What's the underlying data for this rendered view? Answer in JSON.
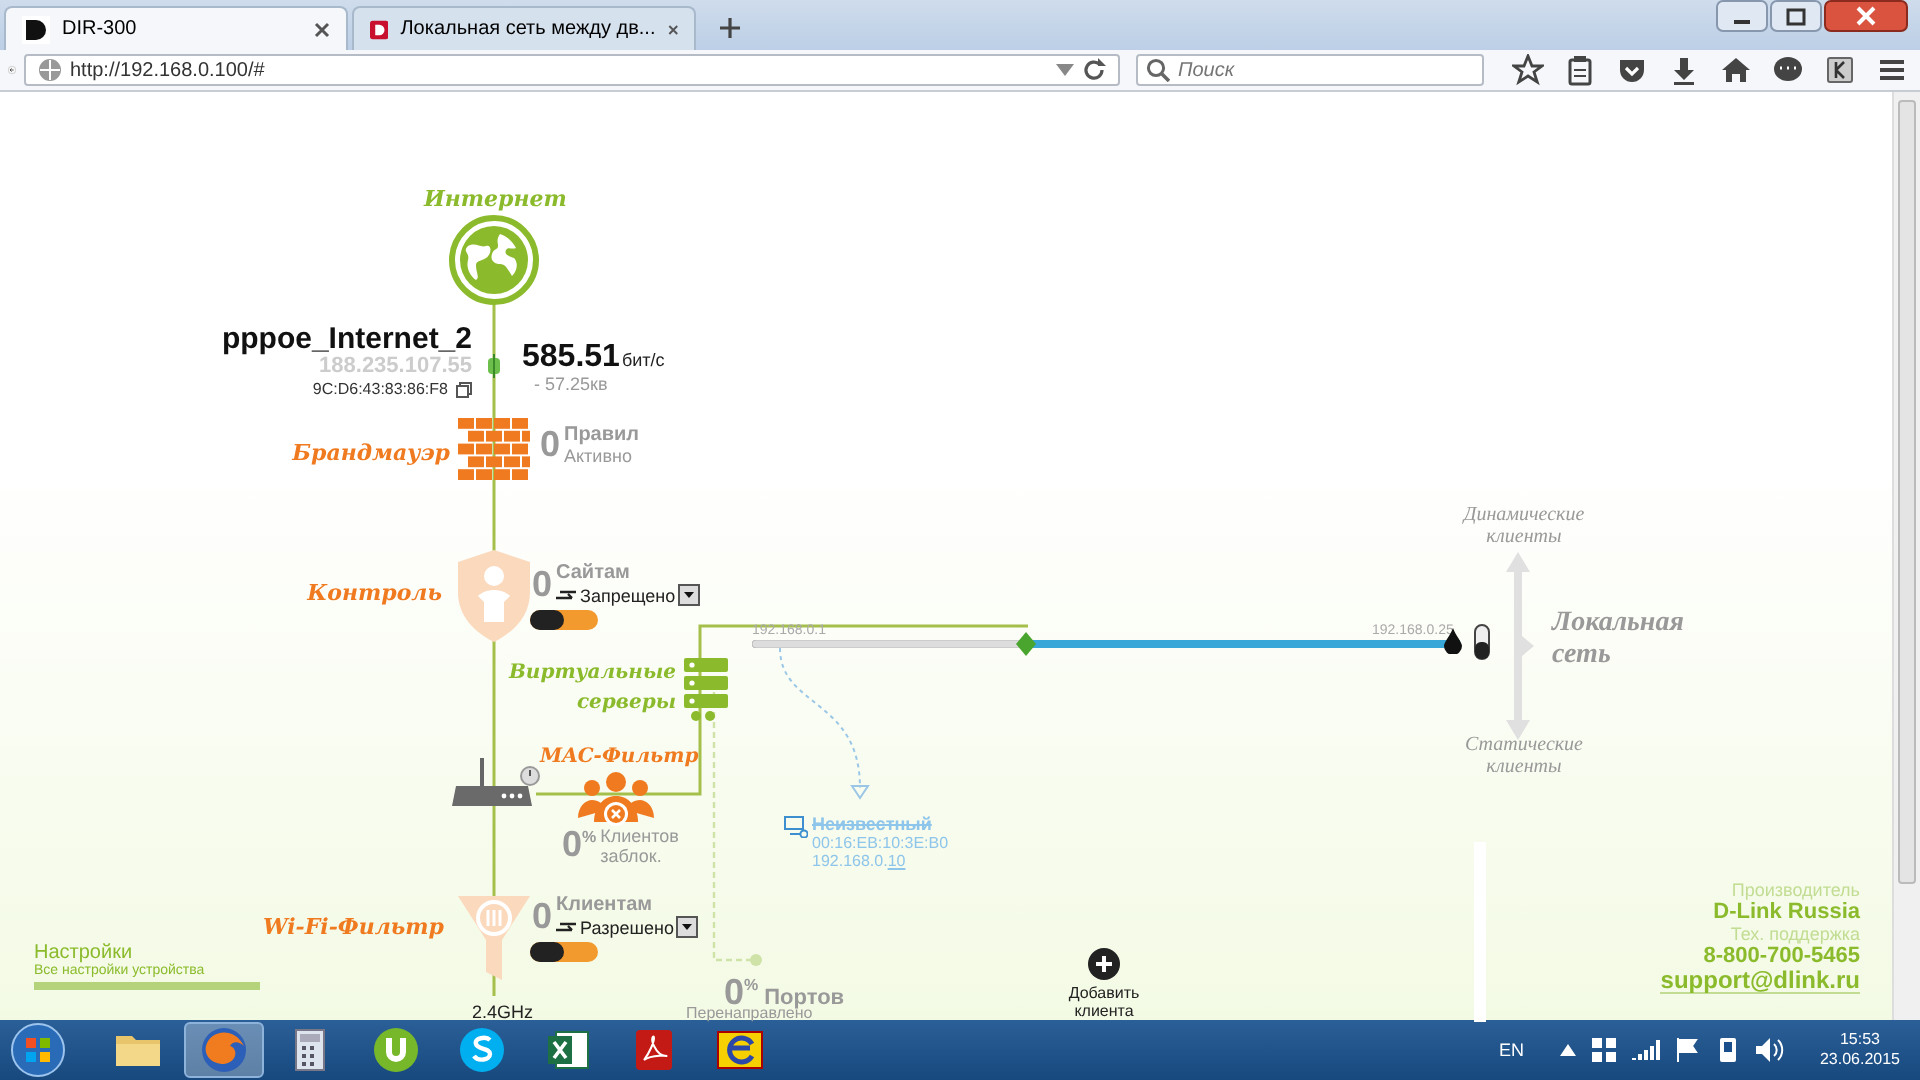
{
  "browser": {
    "tabs": [
      {
        "title": "DIR-300",
        "selected": true
      },
      {
        "title": "Локальная сеть между дв...",
        "selected": false
      }
    ],
    "url": "http://192.168.0.100/#",
    "search": {
      "placeholder": "Поиск"
    }
  },
  "diagram": {
    "internet": {
      "label": "Интернет"
    },
    "connection": {
      "name": "pppoe_Internet_2",
      "ip": "188.235.107.55",
      "mac": "9C:D6:43:83:86:F8",
      "speed": "585.51",
      "speed_unit": "бит/с",
      "traffic": "- 57.25кв"
    },
    "firewall": {
      "label": "Брандмауэр",
      "count": "0",
      "count_label": "Правил",
      "status": "Активно"
    },
    "control": {
      "label": "Контроль",
      "count": "0",
      "count_label": "Сайтам",
      "mode": "Запрещено",
      "on": true
    },
    "virtual_servers": {
      "label": "Виртуальные серверы"
    },
    "mac_filter": {
      "label": "MAC-Фильтр",
      "count": "0$^{%}$",
      "count_label": "Клиентов",
      "status": "заблок."
    },
    "wifi_filter": {
      "label": "Wi-Fi-Фильтр",
      "count": "0",
      "count_label": "Клиентам",
      "mode": "Разрешено",
      "on": true
    },
    "band": "2.4GHz",
    "lan": {
      "gateway_ip": "192.168.0.1",
      "end_ip": "192.168.0.25"
    },
    "client": {
      "name": "Неизвестный",
      "mac": "00:16:EB:10:3E:B0",
      "ip_network": "192.168.0.",
      "ip_host": "10"
    },
    "ports": {
      "count": "0$^{%}$",
      "label": "Портов",
      "status": "Перенаправлено"
    },
    "add_client": "Добавить клиента",
    "local_network": {
      "dynamic": "Динамические клиенты",
      "title": "Локальная сеть",
      "static": "Статические клиенты"
    }
  },
  "settings": {
    "title": "Настройки",
    "subtitle": "Все настройки устройства"
  },
  "vendor": {
    "maker_label": "Производитель",
    "maker": "D-Link Russia",
    "support_label": "Тех. поддержка",
    "phone": "8-800-700-5465",
    "email": "support@dlink.ru"
  },
  "taskbar": {
    "apps": [
      {
        "kind": "folder",
        "selected": false
      },
      {
        "kind": "firefox",
        "selected": true
      },
      {
        "kind": "calculator",
        "selected": false
      },
      {
        "kind": "torrent",
        "selected": false
      },
      {
        "kind": "skype",
        "selected": false
      },
      {
        "kind": "excel",
        "selected": false
      },
      {
        "kind": "pdf",
        "selected": false
      },
      {
        "kind": "ie",
        "selected": false
      }
    ],
    "language": "EN",
    "time": "15:53",
    "date": "23.06.2015"
  }
}
